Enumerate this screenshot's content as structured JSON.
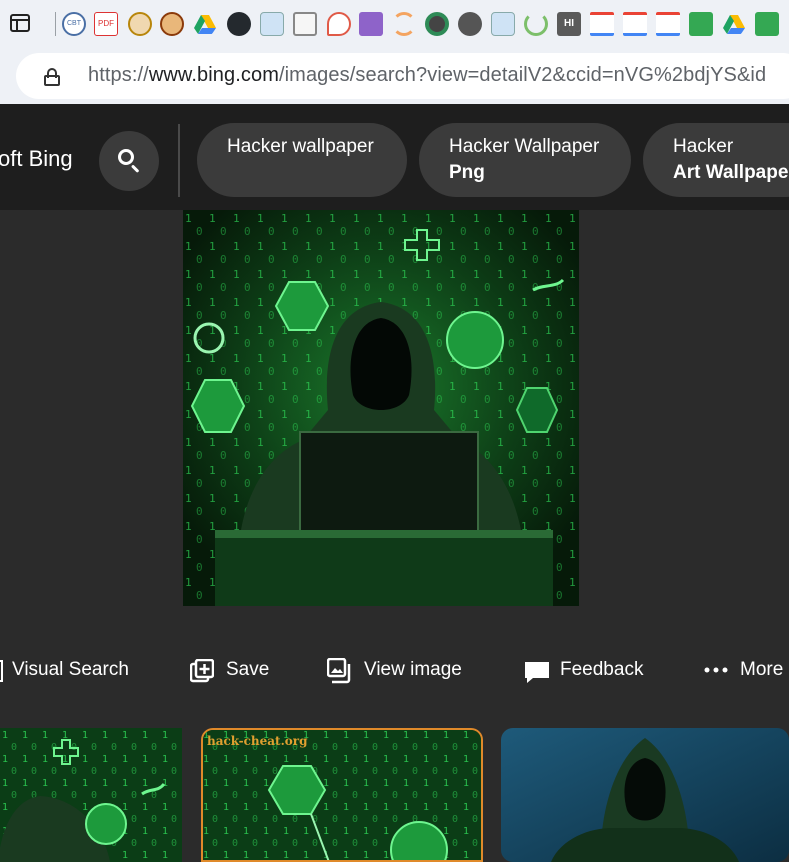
{
  "browser": {
    "address_bar": {
      "url_prefix": "https://",
      "url_domain": "www.bing.com",
      "url_path": "/images/search?view=detailV2&ccid=nVG%2bdjYS&id"
    },
    "bookmarks": [
      {
        "icon": "tab-strip-icon"
      },
      {
        "icon": "cbt-icon",
        "text": "CBT"
      },
      {
        "icon": "pdf-icon",
        "text": "PDF"
      },
      {
        "icon": "emblem-icon"
      },
      {
        "icon": "emblem-icon"
      },
      {
        "icon": "google-drive-icon"
      },
      {
        "icon": "github-icon"
      },
      {
        "icon": "avatar-icon"
      },
      {
        "icon": "signature-icon"
      },
      {
        "icon": "chat-bubble-icon"
      },
      {
        "icon": "list-icon"
      },
      {
        "icon": "arc-icon"
      },
      {
        "icon": "circle-icon"
      },
      {
        "icon": "triangle-icon"
      },
      {
        "icon": "avatar-icon"
      },
      {
        "icon": "leaf-icon"
      },
      {
        "icon": "hi-icon",
        "text": "HI"
      },
      {
        "icon": "gmail-icon"
      },
      {
        "icon": "gmail-icon"
      },
      {
        "icon": "gmail-icon"
      },
      {
        "icon": "sheets-icon"
      },
      {
        "icon": "google-drive-icon"
      },
      {
        "icon": "sheets-icon"
      }
    ]
  },
  "header": {
    "brand": "oft Bing",
    "related_searches": [
      {
        "line1": "Hacker wallpaper",
        "line2": ""
      },
      {
        "line1": "Hacker Wallpaper",
        "line2": "Png"
      },
      {
        "line1": "Hacker",
        "line2": "Art Wallpaper"
      }
    ]
  },
  "actions": [
    {
      "label": "Visual Search",
      "icon": "visual-search-icon"
    },
    {
      "label": "Save",
      "icon": "save-collection-icon"
    },
    {
      "label": "View image",
      "icon": "view-image-icon"
    },
    {
      "label": "Feedback",
      "icon": "feedback-icon"
    },
    {
      "label": "More",
      "icon": "more-icon"
    }
  ],
  "related_images": [
    {
      "caption": ""
    },
    {
      "caption": "hack-cheat.org"
    },
    {
      "caption": ""
    }
  ],
  "colors": {
    "header_bg": "#1e1e1e",
    "page_bg": "#2b2b2b",
    "chip_bg": "#3b3b3b",
    "matrix_green": "#1fd14a",
    "selected_thumb_border": "#e08a2a"
  }
}
